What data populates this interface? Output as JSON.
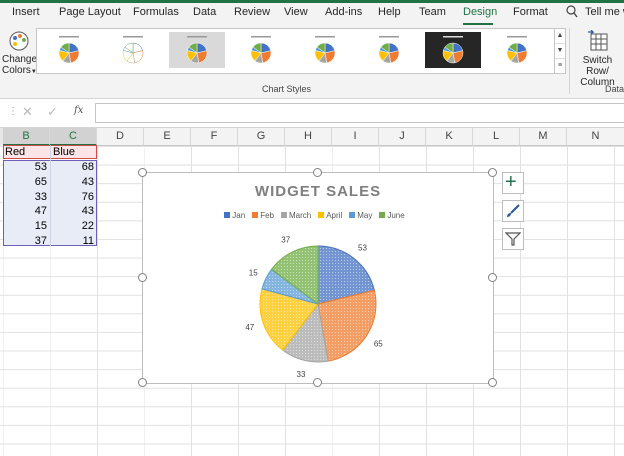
{
  "tabs": [
    {
      "label": "Insert"
    },
    {
      "label": "Page Layout"
    },
    {
      "label": "Formulas"
    },
    {
      "label": "Data"
    },
    {
      "label": "Review"
    },
    {
      "label": "View"
    },
    {
      "label": "Add-ins"
    },
    {
      "label": "Help"
    },
    {
      "label": "Team"
    },
    {
      "label": "Design"
    },
    {
      "label": "Format"
    }
  ],
  "tell_me": "Tell me w",
  "ribbon": {
    "change_colors_line1": "Change",
    "change_colors_line2": "Colors",
    "chart_styles_label": "Chart Styles",
    "switch_row_line1": "Switch Row/",
    "switch_row_line2": "Column",
    "data_label": "Data",
    "style_thumbnails": 8
  },
  "formula_bar": {
    "fx": "fx",
    "value": ""
  },
  "columns": [
    "B",
    "C",
    "D",
    "E",
    "F",
    "G",
    "H",
    "I",
    "J",
    "K",
    "L",
    "M",
    "N"
  ],
  "selected_columns": [
    "B",
    "C"
  ],
  "sheet": {
    "headers": [
      "Red",
      "Blue"
    ],
    "rows": [
      [
        "53",
        "68"
      ],
      [
        "65",
        "43"
      ],
      [
        "33",
        "76"
      ],
      [
        "47",
        "43"
      ],
      [
        "15",
        "22"
      ],
      [
        "37",
        "11"
      ]
    ]
  },
  "chart_data": {
    "type": "pie",
    "title": "WIDGET SALES",
    "categories": [
      "Jan",
      "Feb",
      "March",
      "April",
      "May",
      "June"
    ],
    "values": [
      53,
      65,
      33,
      47,
      15,
      37
    ],
    "colors": [
      "#4472c4",
      "#ed7d31",
      "#a5a5a5",
      "#ffc000",
      "#5b9bd5",
      "#70ad47"
    ],
    "legend_position": "top",
    "data_labels": true
  },
  "chart_side_buttons": [
    "chart-elements",
    "chart-styles",
    "chart-filters"
  ]
}
